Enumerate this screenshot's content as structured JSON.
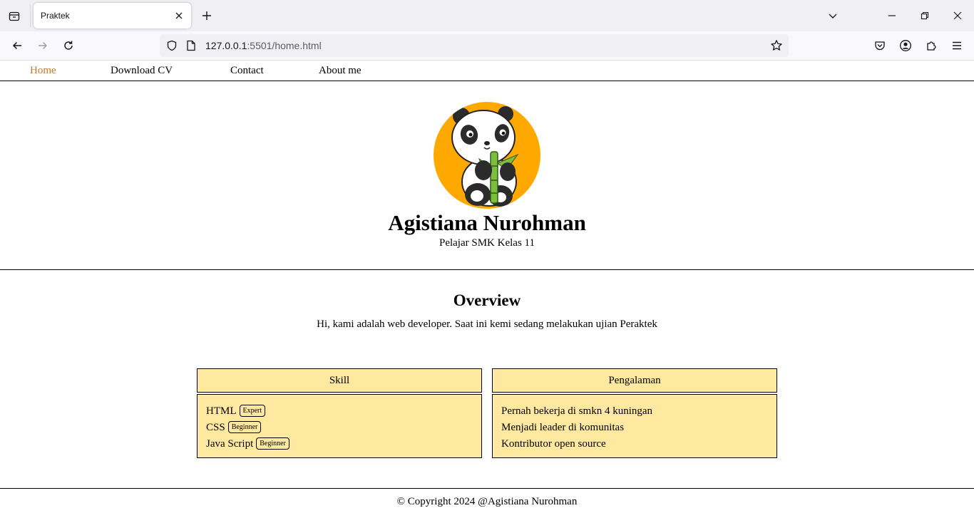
{
  "browser": {
    "tab_title": "Praktek",
    "url_host": "127.0.0.1",
    "url_path": ":5501/home.html"
  },
  "nav": {
    "items": [
      {
        "label": "Home",
        "active": true
      },
      {
        "label": "Download CV"
      },
      {
        "label": "Contact"
      },
      {
        "label": "About me"
      }
    ]
  },
  "profile": {
    "name": "Agistiana Nurohman",
    "subtitle": "Pelajar SMK Kelas 11",
    "avatar_icon": "panda-eating-bamboo",
    "avatar_bg": "#ffa800"
  },
  "overview": {
    "title": "Overview",
    "text": "Hi, kami adalah web developer. Saat ini kemi sedang melakukan ujian Peraktek"
  },
  "skill": {
    "title": "Skill",
    "items": [
      {
        "name": "HTML",
        "level": "Expert"
      },
      {
        "name": "CSS",
        "level": "Beginner"
      },
      {
        "name": "Java Script",
        "level": "Beginner"
      }
    ]
  },
  "experience": {
    "title": "Pengalaman",
    "items": [
      "Pernah bekerja di smkn 4 kuningan",
      "Menjadi leader di komunitas",
      "Kontributor open source"
    ]
  },
  "footer": {
    "text": "© Copyright 2024 @Agistiana Nurohman"
  },
  "colors": {
    "card_bg": "#ffe8a0",
    "nav_active": "#c07a2e"
  }
}
